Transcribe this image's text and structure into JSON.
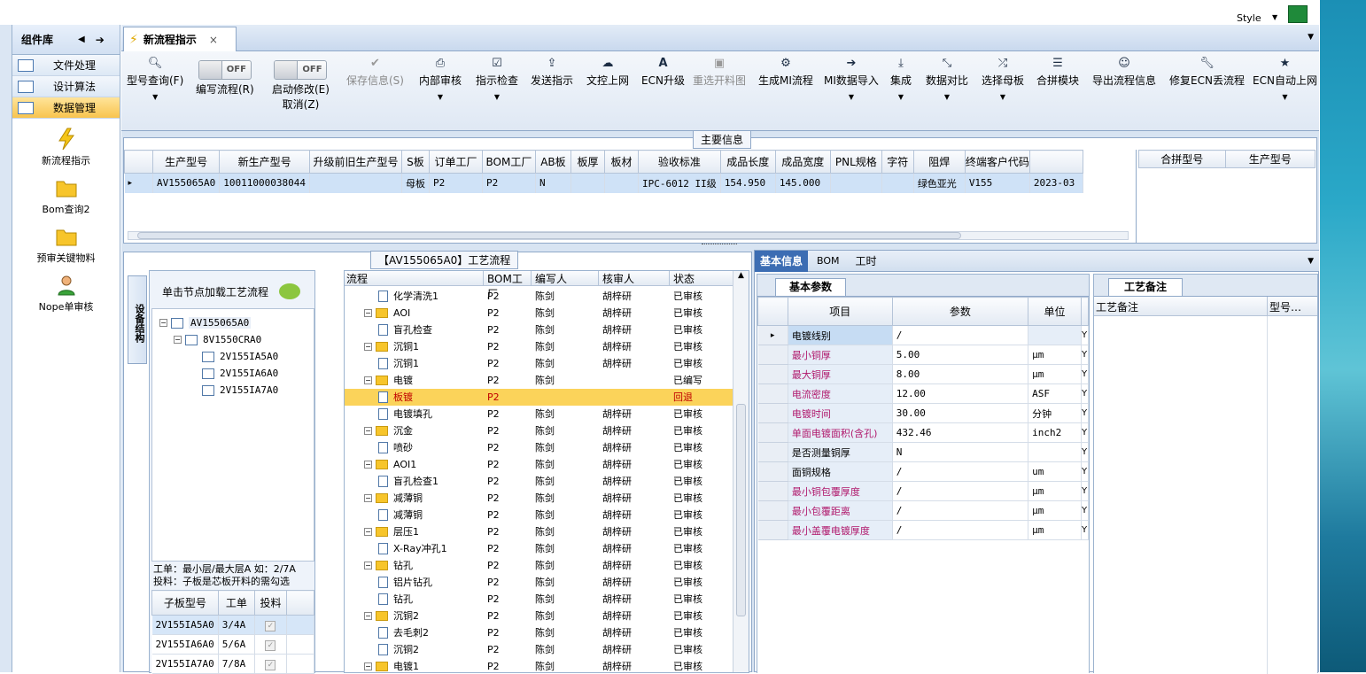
{
  "top": {
    "style_label": "Style"
  },
  "sidebar": {
    "title": "组件库",
    "categories": [
      {
        "label": "文件处理"
      },
      {
        "label": "设计算法"
      },
      {
        "label": "数据管理",
        "selected": true
      }
    ],
    "tools": [
      {
        "label": "新流程指示",
        "icon": "lightning-icon"
      },
      {
        "label": "Bom查询2",
        "icon": "folder-open-icon"
      },
      {
        "label": "预审关键物料",
        "icon": "folder-open-icon"
      },
      {
        "label": "Nope单审核",
        "icon": "user-icon"
      }
    ]
  },
  "tab": {
    "label": "新流程指示"
  },
  "toolbar": {
    "items": [
      {
        "label": "型号查询(F)",
        "icon": "search-icon",
        "dropdown": true
      },
      {
        "label": "编写流程(R)",
        "toggle": "OFF"
      },
      {
        "label": "启动修改(E)",
        "label2": "取消(Z)",
        "toggle": "OFF"
      },
      {
        "label": "保存信息(S)",
        "icon": "check-icon",
        "disabled": true
      },
      {
        "label": "内部审核",
        "icon": "print-icon",
        "dropdown": true
      },
      {
        "label": "指示检查",
        "icon": "checkbox-icon",
        "dropdown": true
      },
      {
        "label": "发送指示",
        "icon": "upload-icon"
      },
      {
        "label": "文控上网",
        "icon": "cloud-upload-icon"
      },
      {
        "label": "ECN升级",
        "icon": "font-icon"
      },
      {
        "label": "重选开料图",
        "icon": "image-icon",
        "disabled": true
      },
      {
        "label": "生成MI流程",
        "icon": "cogs-icon"
      },
      {
        "label": "MI数据导入",
        "icon": "sign-in-icon",
        "dropdown": true
      },
      {
        "label": "集成",
        "icon": "download-icon",
        "dropdown": true
      },
      {
        "label": "数据对比",
        "icon": "compress-icon",
        "dropdown": true
      },
      {
        "label": "选择母板",
        "icon": "random-icon",
        "dropdown": true
      },
      {
        "label": "合拼模块",
        "icon": "list-icon"
      },
      {
        "label": "导出流程信息",
        "icon": "smile-icon"
      },
      {
        "label": "修复ECN丢流程",
        "icon": "wrench-icon"
      },
      {
        "label": "ECN自动上网",
        "icon": "star-icon",
        "dropdown": true
      }
    ]
  },
  "main_info": {
    "title": "主要信息",
    "columns": [
      "生产型号",
      "新生产型号",
      "升级前旧生产型号",
      "S板",
      "订单工厂",
      "BOM工厂",
      "AB板",
      "板厚",
      "板材",
      "验收标准",
      "成品长度",
      "成品宽度",
      "PNL规格",
      "字符",
      "阻焊",
      "终端客户代码"
    ],
    "row": [
      "AV155065A0",
      "10011000038044",
      "",
      "母板",
      "P2",
      "P2",
      "N",
      "",
      "",
      "IPC-6012 II级",
      "154.950",
      "145.000",
      "",
      "",
      "绿色亚光",
      "V155",
      "2023-03"
    ],
    "side_columns": [
      "合拼型号",
      "生产型号"
    ]
  },
  "process": {
    "title": "【AV155065A0】工艺流程",
    "side_tab": "设备结构",
    "hint": "单击节点加载工艺流程",
    "tree": {
      "root": "AV155065A0",
      "child": "8V1550CRA0",
      "leaves": [
        "2V155IA5A0",
        "2V155IA6A0",
        "2V155IA7A0"
      ]
    },
    "note1": "工单：最小层/最大层A 如：2/7A",
    "note2": "投料：子板是芯板开料的需勾选",
    "sub_columns": [
      "子板型号",
      "工单",
      "投料"
    ],
    "sub_rows": [
      [
        "2V155IA5A0",
        "3/4A"
      ],
      [
        "2V155IA6A0",
        "5/6A"
      ],
      [
        "2V155IA7A0",
        "7/8A"
      ]
    ],
    "flow_columns": [
      "流程",
      "BOM工厂",
      "编写人",
      "核审人",
      "状态"
    ],
    "flow_rows": [
      {
        "name": "化学清洗1",
        "type": "doc",
        "f": "P2",
        "w": "陈剑",
        "r": "胡梓研",
        "s": "已审核"
      },
      {
        "name": "AOI",
        "type": "folder",
        "f": "P2",
        "w": "陈剑",
        "r": "胡梓研",
        "s": "已审核"
      },
      {
        "name": "盲孔检查",
        "type": "doc",
        "f": "P2",
        "w": "陈剑",
        "r": "胡梓研",
        "s": "已审核"
      },
      {
        "name": "沉铜1",
        "type": "folder",
        "f": "P2",
        "w": "陈剑",
        "r": "胡梓研",
        "s": "已审核"
      },
      {
        "name": "沉铜1",
        "type": "doc",
        "f": "P2",
        "w": "陈剑",
        "r": "胡梓研",
        "s": "已审核"
      },
      {
        "name": "电镀",
        "type": "folder",
        "f": "P2",
        "w": "陈剑",
        "r": "",
        "s": "已编写"
      },
      {
        "name": "板镀",
        "type": "doc",
        "f": "P2",
        "w": "",
        "r": "",
        "s": "回退",
        "sel": true
      },
      {
        "name": "电镀填孔",
        "type": "doc",
        "f": "P2",
        "w": "陈剑",
        "r": "胡梓研",
        "s": "已审核"
      },
      {
        "name": "沉金",
        "type": "folder",
        "f": "P2",
        "w": "陈剑",
        "r": "胡梓研",
        "s": "已审核"
      },
      {
        "name": "喷砂",
        "type": "doc",
        "f": "P2",
        "w": "陈剑",
        "r": "胡梓研",
        "s": "已审核"
      },
      {
        "name": "AOI1",
        "type": "folder",
        "f": "P2",
        "w": "陈剑",
        "r": "胡梓研",
        "s": "已审核"
      },
      {
        "name": "盲孔检查1",
        "type": "doc",
        "f": "P2",
        "w": "陈剑",
        "r": "胡梓研",
        "s": "已审核"
      },
      {
        "name": "减薄铜",
        "type": "folder",
        "f": "P2",
        "w": "陈剑",
        "r": "胡梓研",
        "s": "已审核"
      },
      {
        "name": "减薄铜",
        "type": "doc",
        "f": "P2",
        "w": "陈剑",
        "r": "胡梓研",
        "s": "已审核"
      },
      {
        "name": "层压1",
        "type": "folder",
        "f": "P2",
        "w": "陈剑",
        "r": "胡梓研",
        "s": "已审核"
      },
      {
        "name": "X-Ray冲孔1",
        "type": "doc",
        "f": "P2",
        "w": "陈剑",
        "r": "胡梓研",
        "s": "已审核"
      },
      {
        "name": "钻孔",
        "type": "folder",
        "f": "P2",
        "w": "陈剑",
        "r": "胡梓研",
        "s": "已审核"
      },
      {
        "name": "铝片钻孔",
        "type": "doc",
        "f": "P2",
        "w": "陈剑",
        "r": "胡梓研",
        "s": "已审核"
      },
      {
        "name": "钻孔",
        "type": "doc",
        "f": "P2",
        "w": "陈剑",
        "r": "胡梓研",
        "s": "已审核"
      },
      {
        "name": "沉铜2",
        "type": "folder",
        "f": "P2",
        "w": "陈剑",
        "r": "胡梓研",
        "s": "已审核"
      },
      {
        "name": "去毛刺2",
        "type": "doc",
        "f": "P2",
        "w": "陈剑",
        "r": "胡梓研",
        "s": "已审核"
      },
      {
        "name": "沉铜2",
        "type": "doc",
        "f": "P2",
        "w": "陈剑",
        "r": "胡梓研",
        "s": "已审核"
      },
      {
        "name": "电镀1",
        "type": "folder",
        "f": "P2",
        "w": "陈剑",
        "r": "胡梓研",
        "s": "已审核"
      }
    ]
  },
  "detail": {
    "tabs": [
      "基本信息",
      "BOM",
      "工时"
    ],
    "sub_tab": "基本参数",
    "columns": [
      "项目",
      "参数",
      "单位"
    ],
    "rows": [
      {
        "item": "电镀线别",
        "value": "/",
        "unit": "",
        "flag": "Y",
        "pink": false
      },
      {
        "item": "最小铜厚",
        "value": "5.00",
        "unit": "μm",
        "flag": "Y",
        "pink": true
      },
      {
        "item": "最大铜厚",
        "value": "8.00",
        "unit": "μm",
        "flag": "Y",
        "pink": true
      },
      {
        "item": "电流密度",
        "value": "12.00",
        "unit": "ASF",
        "flag": "Y",
        "pink": true
      },
      {
        "item": "电镀时间",
        "value": "30.00",
        "unit": "分钟",
        "flag": "Y",
        "pink": true
      },
      {
        "item": "单面电镀面积(含孔)",
        "value": "432.46",
        "unit": "inch2",
        "flag": "Y",
        "pink": true
      },
      {
        "item": "是否测量铜厚",
        "value": "N",
        "unit": "",
        "flag": "Y",
        "pink": false
      },
      {
        "item": "面铜规格",
        "value": "/",
        "unit": "um",
        "flag": "Y",
        "pink": false
      },
      {
        "item": "最小铜包覆厚度",
        "value": "/",
        "unit": "μm",
        "flag": "Y",
        "pink": true
      },
      {
        "item": "最小包覆距离",
        "value": "/",
        "unit": "μm",
        "flag": "Y",
        "pink": true
      },
      {
        "item": "最小盖覆电镀厚度",
        "value": "/",
        "unit": "μm",
        "flag": "Y",
        "pink": true
      }
    ],
    "remark_tab": "工艺备注",
    "remark_columns": [
      "工艺备注",
      "型号…"
    ]
  }
}
